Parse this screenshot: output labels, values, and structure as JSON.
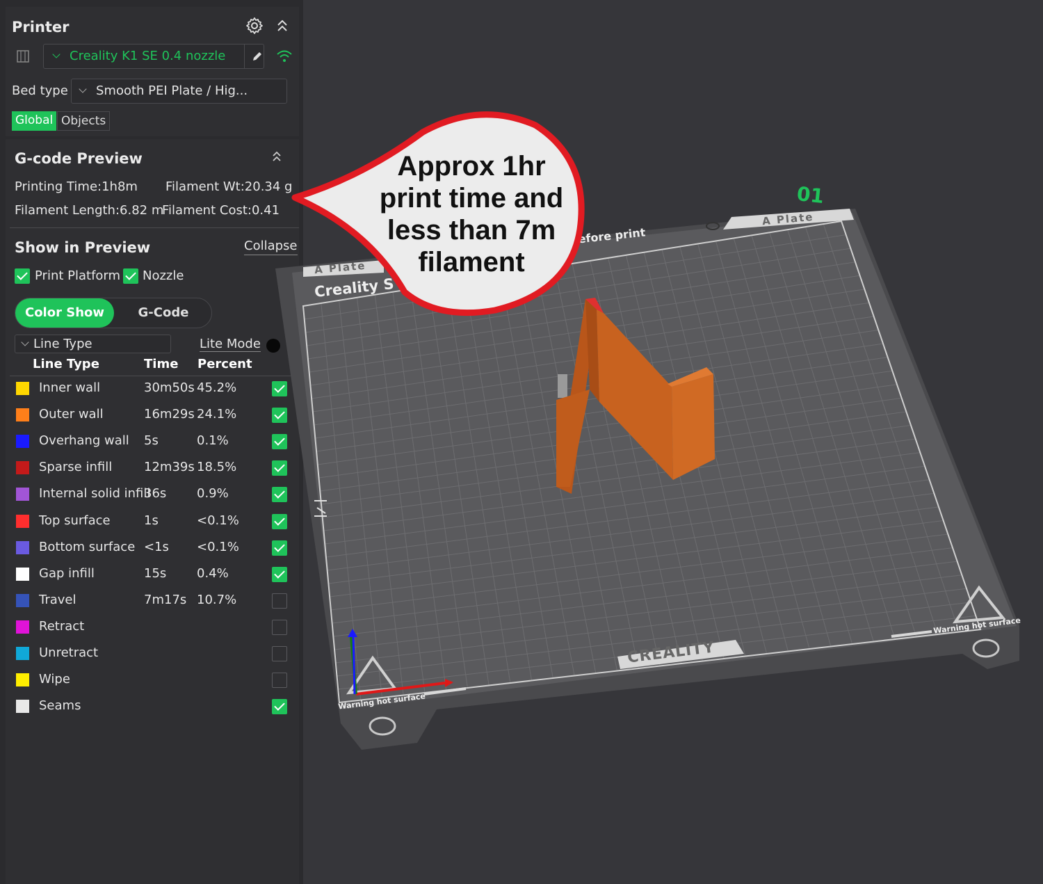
{
  "printer": {
    "title": "Printer",
    "printer_name": "Creality K1 SE 0.4 nozzle",
    "bed_type_label": "Bed type",
    "bed_type_value": "Smooth PEI Plate / Hig...",
    "tabs": [
      "Global",
      "Objects"
    ]
  },
  "preview": {
    "title": "G-code Preview",
    "printing_time": "Printing Time:1h8m",
    "filament_wt": "Filament Wt:20.34 g",
    "filament_length": "Filament Length:6.82 m",
    "filament_cost": "Filament Cost:0.41"
  },
  "show_in_preview": {
    "title": "Show in Preview",
    "collapse": "Collapse",
    "print_platform": "Print Platform",
    "nozzle": "Nozzle",
    "color_show": "Color Show",
    "gcode": "G-Code",
    "line_type_select": "Line Type",
    "lite_mode": "Lite Mode",
    "headers": [
      "Line Type",
      "Time",
      "Percent"
    ],
    "rows": [
      {
        "name": "Inner wall",
        "time": "30m50s",
        "percent": "45.2%",
        "color": "#ffd700",
        "checked": true
      },
      {
        "name": "Outer wall",
        "time": "16m29s",
        "percent": "24.1%",
        "color": "#ff7f1a",
        "checked": true
      },
      {
        "name": "Overhang wall",
        "time": "5s",
        "percent": "0.1%",
        "color": "#1a1aff",
        "checked": true
      },
      {
        "name": "Sparse infill",
        "time": "12m39s",
        "percent": "18.5%",
        "color": "#c41a1a",
        "checked": true
      },
      {
        "name": "Internal solid infill",
        "time": "36s",
        "percent": "0.9%",
        "color": "#a155d6",
        "checked": true
      },
      {
        "name": "Top surface",
        "time": "1s",
        "percent": "<0.1%",
        "color": "#ff2e2e",
        "checked": true
      },
      {
        "name": "Bottom surface",
        "time": "<1s",
        "percent": "<0.1%",
        "color": "#6a5ae0",
        "checked": true
      },
      {
        "name": "Gap infill",
        "time": "15s",
        "percent": "0.4%",
        "color": "#ffffff",
        "checked": true
      },
      {
        "name": "Travel",
        "time": "7m17s",
        "percent": "10.7%",
        "color": "#3553b8",
        "checked": false
      },
      {
        "name": "Retract",
        "time": "",
        "percent": "",
        "color": "#e013d8",
        "checked": false
      },
      {
        "name": "Unretract",
        "time": "",
        "percent": "",
        "color": "#10a8d8",
        "checked": false
      },
      {
        "name": "Wipe",
        "time": "",
        "percent": "",
        "color": "#ffee00",
        "checked": false
      },
      {
        "name": "Seams",
        "time": "",
        "percent": "",
        "color": "#e8e8e8",
        "checked": true
      }
    ]
  },
  "callout": {
    "line1": "Approx 1hr",
    "line2": "print time and",
    "line3": "less than 7m",
    "line4": "filament"
  },
  "scene": {
    "plate_number": "01",
    "plate_label_right": "A Plate",
    "plate_label_left": "A Plate",
    "before_print": "before print",
    "brand_left": "Creality S",
    "brand_bottom": "CREALITY",
    "warning_left": "Warning hot surface",
    "warning_right": "Warning hot surface"
  },
  "colors": {
    "accent": "#1fc35a",
    "callout_border": "#e11b22",
    "model": "#c8621f"
  }
}
